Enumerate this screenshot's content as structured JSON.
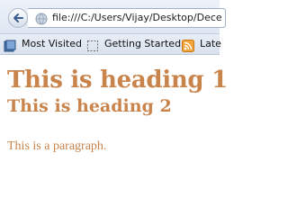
{
  "browser": {
    "url": "file:///C:/Users/Vijay/Desktop/Dece",
    "back_icon": "back-arrow-icon",
    "page_icon": "globe-icon"
  },
  "bookmarks": [
    {
      "label": "Most Visited",
      "icon": "bookmarks-icon"
    },
    {
      "label": "Getting Started",
      "icon": "dashed-page-icon"
    },
    {
      "label": "Late",
      "icon": "rss-feed-icon"
    }
  ],
  "page": {
    "heading1": "This is heading 1",
    "heading2": "This is heading 2",
    "paragraph": "This is a paragraph."
  },
  "colors": {
    "text": "#c9844c",
    "toolbar": "#e4ebf5",
    "rss": "#f2a33a"
  }
}
